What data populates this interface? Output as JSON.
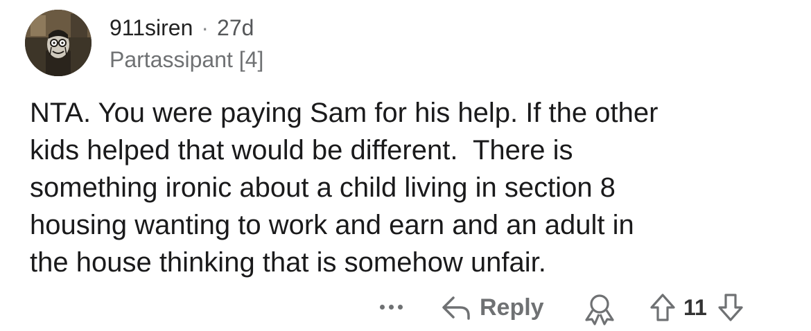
{
  "comment": {
    "author": "911siren",
    "separator": "·",
    "age": "27d",
    "flair": "Partassipant [4]",
    "body_lines": [
      "NTA. You were paying Sam for his help. If the other",
      "kids helped that would be different.  There is",
      "something ironic about a child living in section 8",
      "housing wanting to work and earn and an adult in",
      "the house thinking that is somehow unfair."
    ]
  },
  "actions": {
    "more_icon": "ellipsis-icon",
    "reply_icon": "reply-arrow-icon",
    "reply_label": "Reply",
    "award_icon": "award-icon",
    "upvote_icon": "upvote-arrow-icon",
    "score": "11",
    "downvote_icon": "downvote-arrow-icon"
  },
  "colors": {
    "text": "#1a1a1b",
    "muted": "#6f7173",
    "background": "#ffffff"
  }
}
